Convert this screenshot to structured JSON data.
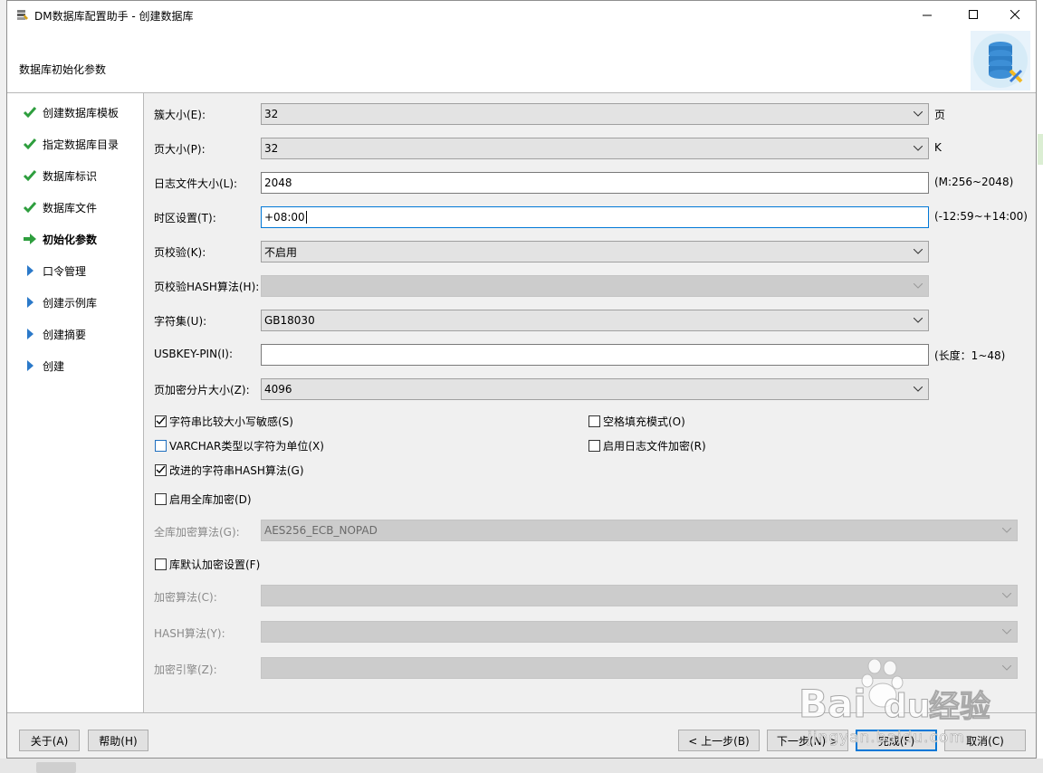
{
  "window": {
    "title": "DM数据库配置助手 - 创建数据库",
    "heading": "数据库初始化参数"
  },
  "steps": [
    {
      "label": "创建数据库模板",
      "status": "done"
    },
    {
      "label": "指定数据库目录",
      "status": "done"
    },
    {
      "label": "数据库标识",
      "status": "done"
    },
    {
      "label": "数据库文件",
      "status": "done"
    },
    {
      "label": "初始化参数",
      "status": "current"
    },
    {
      "label": "口令管理",
      "status": "pending"
    },
    {
      "label": "创建示例库",
      "status": "pending"
    },
    {
      "label": "创建摘要",
      "status": "pending"
    },
    {
      "label": "创建",
      "status": "pending"
    }
  ],
  "form": {
    "extent_size": {
      "label": "簇大小(E):",
      "value": "32",
      "unit": "页"
    },
    "page_size": {
      "label": "页大小(P):",
      "value": "32",
      "unit": "K"
    },
    "log_size": {
      "label": "日志文件大小(L):",
      "value": "2048",
      "hint": "(M:256~2048)"
    },
    "time_zone": {
      "label": "时区设置(T):",
      "value": "+08:00",
      "hint": "(-12:59~+14:00)"
    },
    "page_check": {
      "label": "页校验(K):",
      "value": "不启用"
    },
    "page_check_hash": {
      "label": "页校验HASH算法(H):",
      "value": ""
    },
    "charset": {
      "label": "字符集(U):",
      "value": "GB18030"
    },
    "usbkey_pin": {
      "label": "USBKEY-PIN(I):",
      "value": "",
      "hint": "(长度：1~48)"
    },
    "page_enc_slice": {
      "label": "页加密分片大小(Z):",
      "value": "4096"
    }
  },
  "checkboxes": {
    "case_sensitive": {
      "label": "字符串比较大小写敏感(S)",
      "checked": true
    },
    "blank_pad": {
      "label": "空格填充模式(O)",
      "checked": false
    },
    "varchar_char": {
      "label": "VARCHAR类型以字符为单位(X)",
      "checked": false
    },
    "log_encrypt": {
      "label": "启用日志文件加密(R)",
      "checked": false
    },
    "improved_hash": {
      "label": "改进的字符串HASH算法(G)",
      "checked": true
    },
    "full_db_encrypt": {
      "label": "启用全库加密(D)",
      "checked": false
    },
    "default_encrypt": {
      "label": "库默认加密设置(F)",
      "checked": false
    }
  },
  "encryption": {
    "full_db_algo": {
      "label": "全库加密算法(G):",
      "value": "AES256_ECB_NOPAD"
    },
    "algo": {
      "label": "加密算法(C):",
      "value": ""
    },
    "hash_algo": {
      "label": "HASH算法(Y):",
      "value": ""
    },
    "engine": {
      "label": "加密引擎(Z):",
      "value": ""
    }
  },
  "buttons": {
    "about": "关于(A)",
    "help": "帮助(H)",
    "prev": "< 上一步(B)",
    "next": "下一步(N) >",
    "finish": "完成(F)",
    "cancel": "取消(C)"
  },
  "watermark": {
    "brand": "Bai",
    "brand_suffix": "du",
    "product": "经验",
    "url": "jingyan.baidu.com"
  },
  "colors": {
    "check_green": "#2e9e3e",
    "arrow_green": "#2e9e3e",
    "pending_blue": "#2b79c9",
    "focus_blue": "#0078d7"
  }
}
